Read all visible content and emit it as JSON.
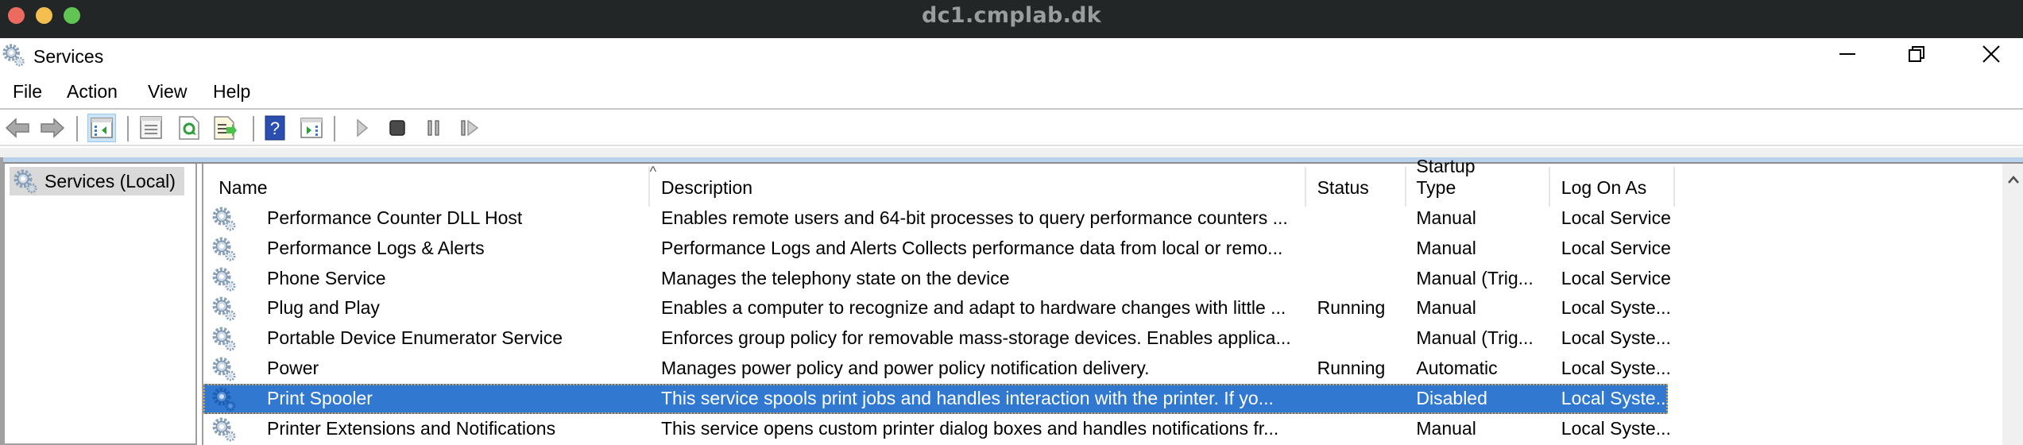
{
  "mac_window": {
    "title": "dc1.cmplab.dk"
  },
  "window": {
    "title": "Services",
    "controls": {
      "minimize": "minimize",
      "maximize": "restore",
      "close": "close"
    }
  },
  "menu": [
    "File",
    "Action",
    "View",
    "Help"
  ],
  "toolbar": {
    "buttons": [
      {
        "name": "back",
        "icon": "back-arrow-icon"
      },
      {
        "name": "forward",
        "icon": "forward-arrow-icon"
      },
      {
        "name": "show-hide-console-tree",
        "icon": "console-tree-icon",
        "active": true
      },
      {
        "name": "properties",
        "icon": "properties-icon"
      },
      {
        "name": "refresh",
        "icon": "refresh-icon"
      },
      {
        "name": "export-list",
        "icon": "export-list-icon"
      },
      {
        "name": "help",
        "icon": "help-icon"
      },
      {
        "name": "show-hide-action-pane",
        "icon": "action-pane-icon"
      },
      {
        "name": "start-service",
        "icon": "play-icon"
      },
      {
        "name": "stop-service",
        "icon": "stop-icon"
      },
      {
        "name": "pause-service",
        "icon": "pause-icon"
      },
      {
        "name": "resume-service",
        "icon": "resume-icon"
      }
    ]
  },
  "tree": {
    "items": [
      {
        "label": "Services (Local)",
        "selected": true
      }
    ]
  },
  "list": {
    "columns": [
      "Name",
      "Description",
      "Status",
      "Startup Type",
      "Log On As"
    ],
    "sort_column": "Name",
    "sort_indicator": "^",
    "rows": [
      {
        "name": "Performance Counter DLL Host",
        "description": "Enables remote users and 64-bit processes to query performance counters ...",
        "status": "",
        "startup": "Manual",
        "logon": "Local Service",
        "selected": false
      },
      {
        "name": "Performance Logs & Alerts",
        "description": "Performance Logs and Alerts Collects performance data from local or remo...",
        "status": "",
        "startup": "Manual",
        "logon": "Local Service",
        "selected": false
      },
      {
        "name": "Phone Service",
        "description": "Manages the telephony state on the device",
        "status": "",
        "startup": "Manual (Trig...",
        "logon": "Local Service",
        "selected": false
      },
      {
        "name": "Plug and Play",
        "description": "Enables a computer to recognize and adapt to hardware changes with little ...",
        "status": "Running",
        "startup": "Manual",
        "logon": "Local Syste...",
        "selected": false
      },
      {
        "name": "Portable Device Enumerator Service",
        "description": "Enforces group policy for removable mass-storage devices. Enables applica...",
        "status": "",
        "startup": "Manual (Trig...",
        "logon": "Local Syste...",
        "selected": false
      },
      {
        "name": "Power",
        "description": "Manages power policy and power policy notification delivery.",
        "status": "Running",
        "startup": "Automatic",
        "logon": "Local Syste...",
        "selected": false
      },
      {
        "name": "Print Spooler",
        "description": "This service spools print jobs and handles interaction with the printer.  If yo...",
        "status": "",
        "startup": "Disabled",
        "logon": "Local Syste...",
        "selected": true
      },
      {
        "name": "Printer Extensions and Notifications",
        "description": "This service opens custom printer dialog boxes and handles notifications fr...",
        "status": "",
        "startup": "Manual",
        "logon": "Local Syste...",
        "selected": false
      }
    ]
  },
  "colors": {
    "selection": "#3078d0",
    "mac_bar": "#222626"
  }
}
